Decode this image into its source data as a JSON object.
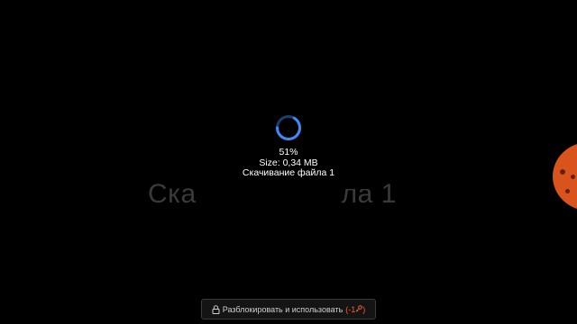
{
  "background": {
    "title_left": "Ска",
    "title_right": "ла 1"
  },
  "download": {
    "percent": "51%",
    "size": "Size: 0,34 MB",
    "status": "Скачивание файла 1",
    "progress_fraction": 0.51,
    "spinner_color": "#3d8af7"
  },
  "unlock_button": {
    "label": "Разблокировать и использовать",
    "cost": "(-1",
    "cost_close": ")",
    "accent_color": "#e8632a"
  }
}
